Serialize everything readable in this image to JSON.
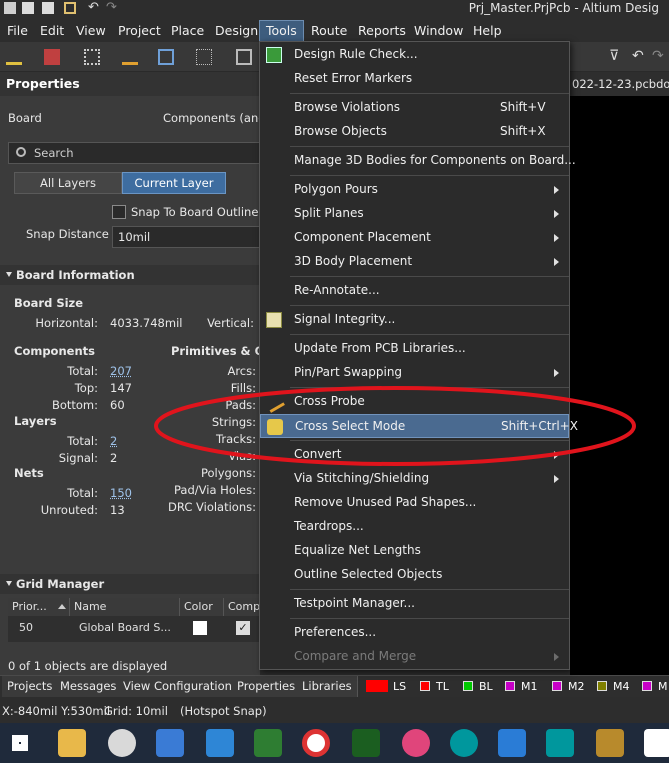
{
  "app": {
    "title": "Prj_Master.PrjPcb - Altium Desig"
  },
  "menubar": {
    "items": [
      "File",
      "Edit",
      "View",
      "Project",
      "Place",
      "Design",
      "Tools",
      "Route",
      "Reports",
      "Window",
      "Help"
    ],
    "active": "Tools"
  },
  "document_tab": "022-12-23.pcbdoc",
  "properties": {
    "header": "Properties",
    "filter_board": "Board",
    "filter_components": "Components (and",
    "search_placeholder": "Search",
    "layer_buttons": [
      "All Layers",
      "Current Layer"
    ],
    "selected_layer_button": "Current Layer",
    "snap_to_board_outline": "Snap To Board Outline",
    "snap_distance_label": "Snap Distance",
    "snap_distance_value": "10mil",
    "board_information": {
      "title": "Board Information",
      "board_size": "Board Size",
      "horizontal_label": "Horizontal:",
      "horizontal_value": "4033.748mil",
      "vertical_label": "Vertical:",
      "components": "Components",
      "total_label": "Total:",
      "components_total": "207",
      "top_label": "Top:",
      "components_top": "147",
      "bottom_label": "Bottom:",
      "components_bottom": "60",
      "layers": "Layers",
      "layers_total": "2",
      "signal_label": "Signal:",
      "layers_signal": "2",
      "nets": "Nets",
      "nets_total": "150",
      "unrouted_label": "Unrouted:",
      "nets_unrouted": "13",
      "primitives": "Primitives & Othe",
      "arcs": "Arcs:",
      "fills": "Fills:",
      "pads": "Pads:",
      "strings": "Strings:",
      "tracks": "Tracks:",
      "vias": "Vias:",
      "polygons": "Polygons:",
      "pad_via_holes": "Pad/Via Holes:",
      "drc_violations": "DRC Violations:"
    },
    "grid_manager": {
      "title": "Grid Manager",
      "columns": [
        "Prior...",
        "Name",
        "Color",
        "Comp"
      ],
      "rows": [
        {
          "priority": "50",
          "name": "Global Board S..."
        }
      ]
    },
    "objects_status": "0 of 1 objects are displayed"
  },
  "tools_menu": {
    "items": [
      {
        "label": "Design Rule Check...",
        "shortcut": ""
      },
      {
        "label": "Reset Error Markers",
        "shortcut": ""
      },
      {
        "label": "Browse Violations",
        "shortcut": "Shift+V"
      },
      {
        "label": "Browse Objects",
        "shortcut": "Shift+X"
      },
      {
        "label": "Manage 3D Bodies for Components on Board...",
        "shortcut": ""
      },
      {
        "label": "Polygon Pours",
        "shortcut": ""
      },
      {
        "label": "Split Planes",
        "shortcut": ""
      },
      {
        "label": "Component Placement",
        "shortcut": ""
      },
      {
        "label": "3D Body Placement",
        "shortcut": ""
      },
      {
        "label": "Re-Annotate...",
        "shortcut": ""
      },
      {
        "label": "Signal Integrity...",
        "shortcut": ""
      },
      {
        "label": "Update From PCB Libraries...",
        "shortcut": ""
      },
      {
        "label": "Pin/Part Swapping",
        "shortcut": ""
      },
      {
        "label": "Cross Probe",
        "shortcut": ""
      },
      {
        "label": "Cross Select Mode",
        "shortcut": "Shift+Ctrl+X"
      },
      {
        "label": "Convert",
        "shortcut": ""
      },
      {
        "label": "Via Stitching/Shielding",
        "shortcut": ""
      },
      {
        "label": "Remove Unused Pad Shapes...",
        "shortcut": ""
      },
      {
        "label": "Teardrops...",
        "shortcut": ""
      },
      {
        "label": "Equalize Net Lengths",
        "shortcut": ""
      },
      {
        "label": "Outline Selected Objects",
        "shortcut": ""
      },
      {
        "label": "Testpoint Manager...",
        "shortcut": ""
      },
      {
        "label": "Preferences...",
        "shortcut": ""
      },
      {
        "label": "Compare and Merge",
        "shortcut": ""
      }
    ],
    "highlighted": "Cross Select Mode",
    "disabled": [
      "Compare and Merge"
    ]
  },
  "panel_tabs": [
    "Projects",
    "Messages",
    "View Configuration",
    "Properties",
    "Libraries"
  ],
  "layers": [
    {
      "label": "LS",
      "color": "#ff0000"
    },
    {
      "label": "TL",
      "color": "#ff0000"
    },
    {
      "label": "BL",
      "color": "#00c800"
    },
    {
      "label": "M1",
      "color": "#c800c8"
    },
    {
      "label": "M2",
      "color": "#c800c8"
    },
    {
      "label": "M4",
      "color": "#808000"
    },
    {
      "label": "M",
      "color": "#c800c8"
    }
  ],
  "status": {
    "coords": "X:-840mil Y:530mil",
    "grid": "Grid: 10mil",
    "snap": "(Hotspot Snap)"
  },
  "colors": {
    "annotation": "#e0141c",
    "menu_highlight": "#4a6a90",
    "active_button": "#3e6da0"
  }
}
